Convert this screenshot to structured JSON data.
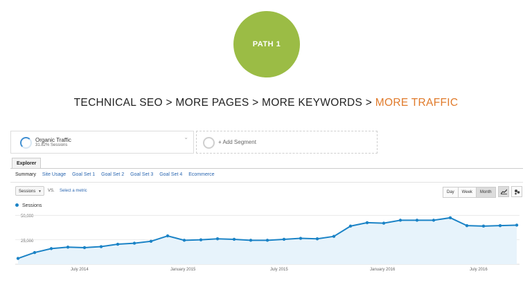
{
  "badge": {
    "label": "PATH 1"
  },
  "headline": {
    "part1": "TECHNICAL SEO > MORE PAGES > MORE KEYWORDS > ",
    "accent": "MORE TRAFFIC"
  },
  "segments": {
    "primary": {
      "title": "Organic Traffic",
      "subtitle": "31.82% Sessions"
    },
    "add_label": "+ Add Segment"
  },
  "tabs": {
    "main": "Explorer"
  },
  "subtabs": [
    "Summary",
    "Site Usage",
    "Goal Set 1",
    "Goal Set 2",
    "Goal Set 3",
    "Goal Set 4",
    "Ecommerce"
  ],
  "controls": {
    "metric": "Sessions",
    "vs": "VS.",
    "select_metric": "Select a metric",
    "ranges": [
      "Day",
      "Week",
      "Month"
    ],
    "active_range": "Month"
  },
  "colors": {
    "line": "#1b83c6",
    "fill": "#e7f3fb",
    "badge": "#9bbc45",
    "accent": "#e07a2a"
  },
  "chart_data": {
    "type": "area",
    "series": [
      {
        "name": "Sessions",
        "values": [
          6000,
          12000,
          16000,
          17500,
          17000,
          18000,
          20500,
          21500,
          23500,
          29000,
          24500,
          25000,
          26000,
          25500,
          24500,
          24500,
          25500,
          26500,
          26000,
          28500,
          39000,
          42500,
          42000,
          45000,
          45000,
          45000,
          47500,
          39500,
          39000,
          39500,
          40000
        ]
      }
    ],
    "yticks": [
      "50,000",
      "25,000"
    ],
    "ytick_values": [
      50000,
      25000
    ],
    "ylim": [
      0,
      58000
    ],
    "xticks": [
      {
        "label": "July 2014",
        "index": 4
      },
      {
        "label": "January 2015",
        "index": 10
      },
      {
        "label": "July 2015",
        "index": 16
      },
      {
        "label": "January 2016",
        "index": 22
      },
      {
        "label": "July 2016",
        "index": 28
      }
    ],
    "grid": true
  }
}
